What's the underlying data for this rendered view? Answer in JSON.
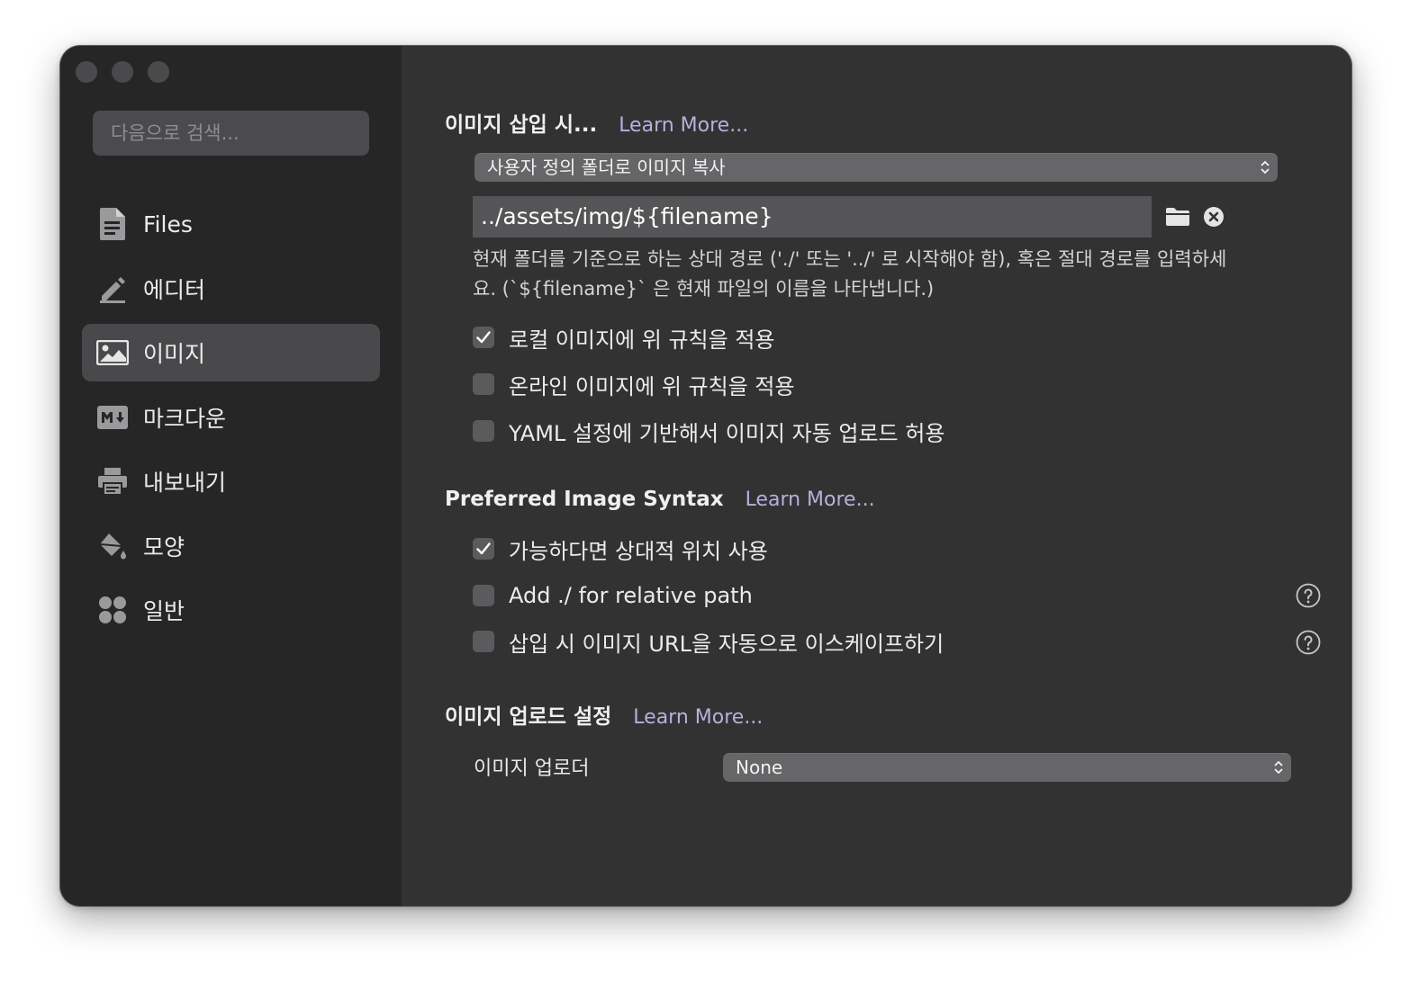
{
  "search": {
    "placeholder": "다음으로 검색..."
  },
  "sidebar": {
    "items": [
      {
        "label": "Files",
        "icon": "document-icon",
        "active": false
      },
      {
        "label": "에디터",
        "icon": "pencil-icon",
        "active": false
      },
      {
        "label": "이미지",
        "icon": "image-icon",
        "active": true
      },
      {
        "label": "마크다운",
        "icon": "markdown-icon",
        "active": false
      },
      {
        "label": "내보내기",
        "icon": "printer-icon",
        "active": false
      },
      {
        "label": "모양",
        "icon": "paint-bucket-icon",
        "active": false
      },
      {
        "label": "일반",
        "icon": "grid-dots-icon",
        "active": false
      }
    ]
  },
  "main": {
    "insert": {
      "title": "이미지 삽입 시...",
      "learn_more": "Learn More...",
      "action_select": "사용자 정의 폴더로 이미지 복사",
      "path_value": "../assets/img/${filename}",
      "hint": "현재 폴더를 기준으로 하는 상대 경로 ('./' 또는 '../' 로 시작해야 함), 혹은 절대 경로를 입력하세\n요. (`${filename}` 은 현재 파일의 이름을 나타냅니다.)",
      "options": [
        {
          "label": "로컬 이미지에 위 규칙을 적용",
          "checked": true
        },
        {
          "label": "온라인 이미지에 위 규칙을 적용",
          "checked": false
        },
        {
          "label": "YAML 설정에 기반해서 이미지 자동 업로드 허용",
          "checked": false
        }
      ]
    },
    "syntax": {
      "title": "Preferred Image Syntax",
      "learn_more": "Learn More...",
      "options": [
        {
          "label": "가능하다면 상대적 위치 사용",
          "checked": true
        },
        {
          "label": "Add ./ for relative path",
          "checked": false
        },
        {
          "label": "삽입 시 이미지 URL을 자동으로 이스케이프하기",
          "checked": false
        }
      ]
    },
    "upload": {
      "title": "이미지 업로드 설정",
      "learn_more": "Learn More...",
      "uploader_label": "이미지 업로더",
      "uploader_value": "None"
    }
  },
  "colors": {
    "accent_link": "#b4b1dc",
    "window_bg": "#323233",
    "sidebar_bg": "#262627"
  }
}
